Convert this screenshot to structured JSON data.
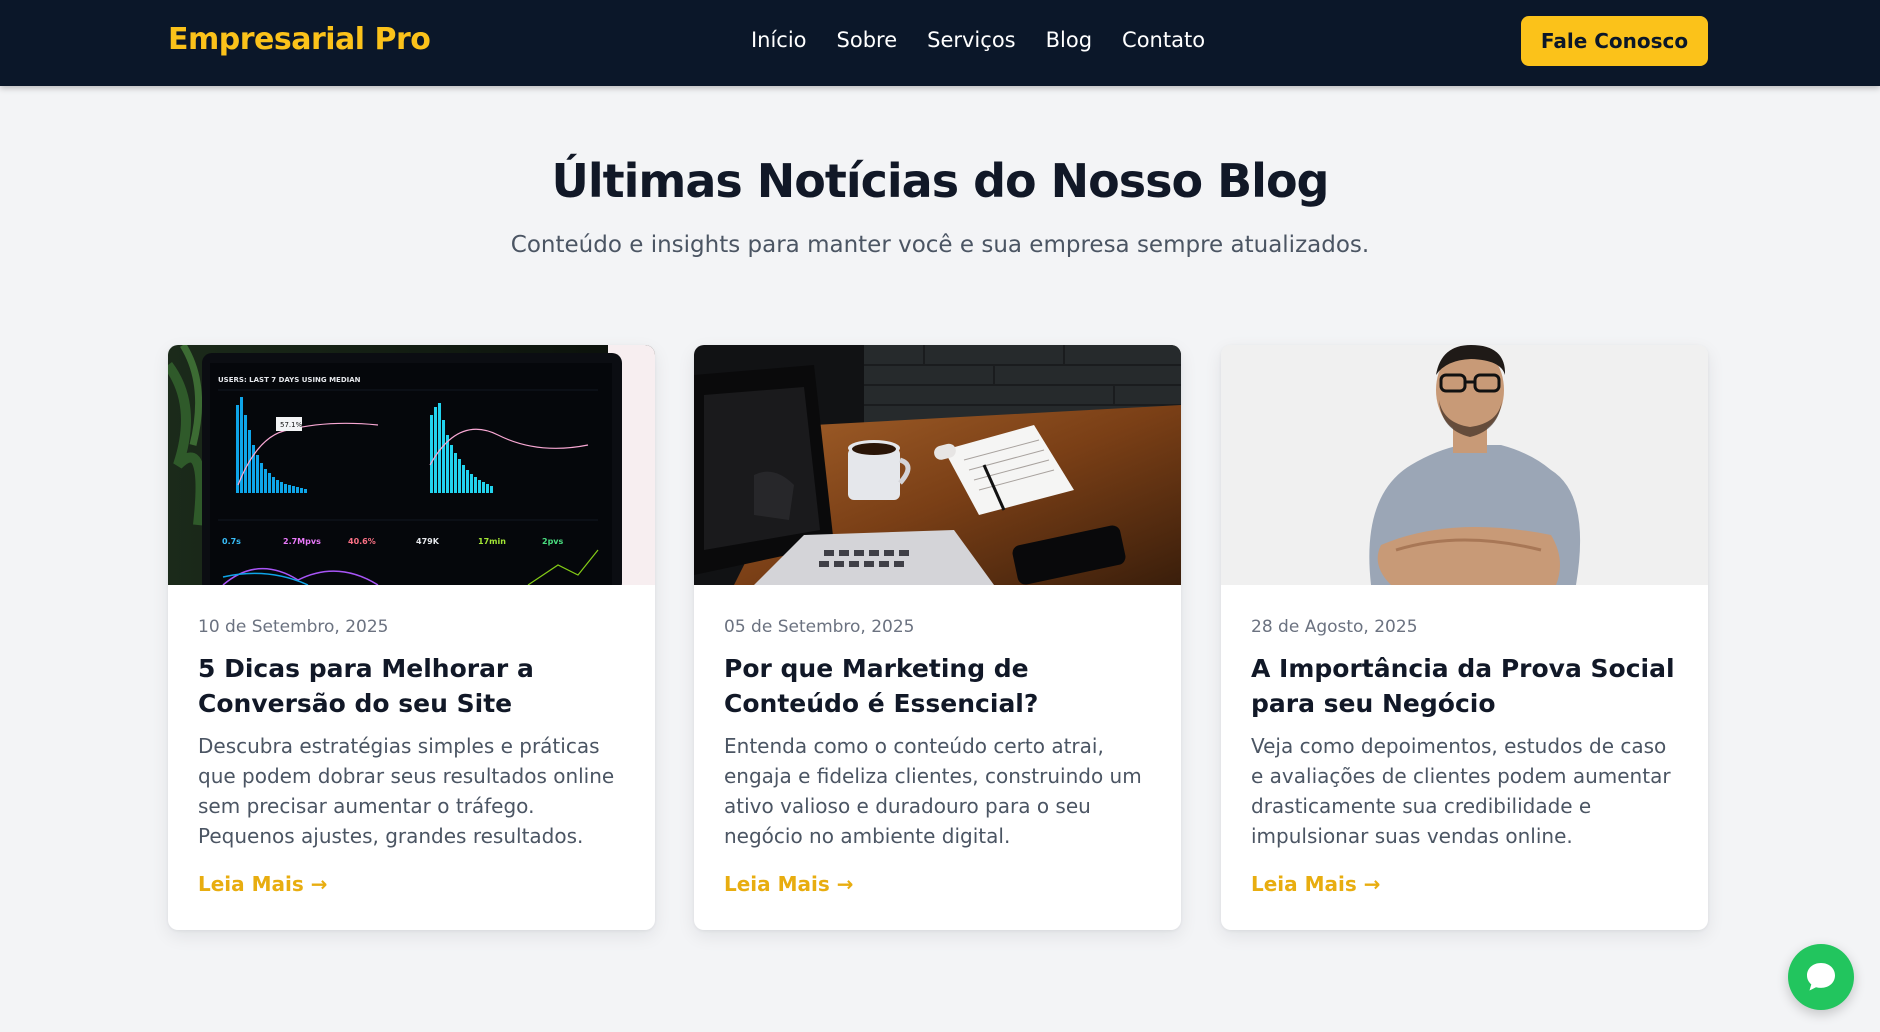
{
  "header": {
    "brand": "Empresarial Pro",
    "nav": [
      "Início",
      "Sobre",
      "Serviços",
      "Blog",
      "Contato"
    ],
    "cta_label": "Fale Conosco"
  },
  "blog": {
    "title": "Últimas Notícias do Nosso Blog",
    "subtitle": "Conteúdo e insights para manter você e sua empresa sempre atualizados.",
    "posts": [
      {
        "date": "10 de Setembro, 2025",
        "title": "5 Dicas para Melhorar a Conversão do seu Site",
        "excerpt": "Descubra estratégias simples e práticas que podem dobrar seus resultados online sem precisar aumentar o tráfego. Pequenos ajustes, grandes resultados.",
        "read_more": "Leia Mais →",
        "image_icon": "analytics-dashboard-image",
        "image_text": {
          "heading": "USERS: LAST 7 DAYS USING MEDIAN",
          "tooltip": "57.1%",
          "stats": [
            "0.7s",
            "2.7Mpvs",
            "40.6%",
            "479K",
            "17min",
            "2pvs"
          ]
        }
      },
      {
        "date": "05 de Setembro, 2025",
        "title": "Por que Marketing de Conteúdo é Essencial?",
        "excerpt": "Entenda como o conteúdo certo atrai, engaja e fideliza clientes, construindo um ativo valioso e duradouro para o seu negócio no ambiente digital.",
        "read_more": "Leia Mais →",
        "image_icon": "desk-laptop-coffee-image"
      },
      {
        "date": "28 de Agosto, 2025",
        "title": "A Importância da Prova Social para seu Negócio",
        "excerpt": "Veja como depoimentos, estudos de caso e avaliações de clientes podem aumentar drasticamente sua credibilidade e impulsionar suas vendas online.",
        "read_more": "Leia Mais →",
        "image_icon": "man-portrait-image"
      }
    ]
  },
  "colors": {
    "navbar": "#0b1729",
    "accent": "#fbc21a",
    "link": "#e8ad10",
    "chat": "#22c55e"
  },
  "chat": {
    "icon": "chat-bubble-icon"
  }
}
